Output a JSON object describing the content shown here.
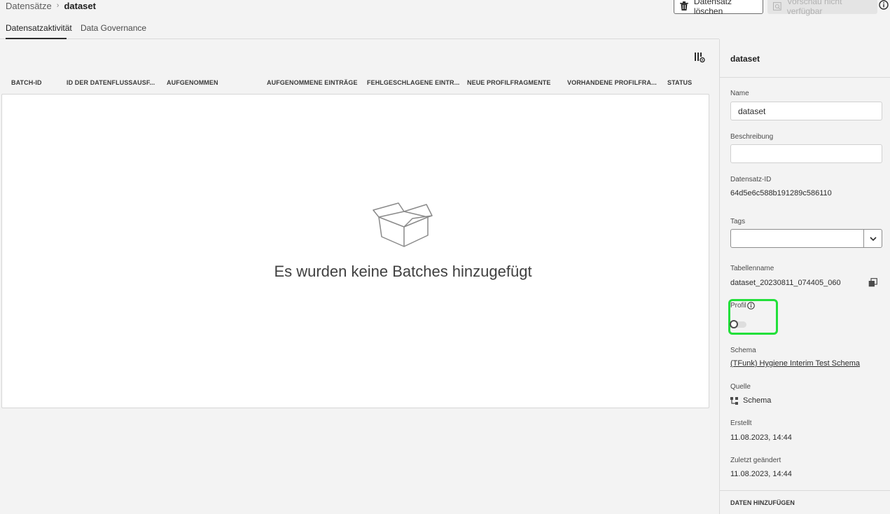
{
  "breadcrumb": {
    "parent": "Datensätze",
    "separator": "›",
    "current": "dataset"
  },
  "actions": {
    "delete_label": "Datensatz löschen",
    "preview_label": "Vorschau nicht verfügbar"
  },
  "tabs": [
    {
      "label": "Datensatzaktivität",
      "active": true
    },
    {
      "label": "Data Governance",
      "active": false
    }
  ],
  "table": {
    "columns": [
      "BATCH-ID",
      "ID DER DATENFLUSSAUSF...",
      "AUFGENOMMEN",
      "AUFGENOMMENE EINTRÄGE",
      "FEHLGESCHLAGENE EINTR...",
      "NEUE PROFILFRAGMENTE",
      "VORHANDENE PROFILFRA...",
      "STATUS"
    ],
    "rows": [],
    "empty_message": "Es wurden keine Batches hinzugefügt"
  },
  "panel": {
    "title": "dataset",
    "name_label": "Name",
    "name_value": "dataset",
    "description_label": "Beschreibung",
    "description_value": "",
    "dataset_id_label": "Datensatz-ID",
    "dataset_id_value": "64d5e6c588b191289c586110",
    "tags_label": "Tags",
    "table_name_label": "Tabellenname",
    "table_name_value": "dataset_20230811_074405_060",
    "profile_label": "Profil",
    "profile_enabled": false,
    "schema_label": "Schema",
    "schema_value": "(TFunk) Hygiene Interim Test Schema",
    "source_label": "Quelle",
    "source_value": "Schema",
    "created_label": "Erstellt",
    "created_value": "11.08.2023, 14:44",
    "modified_label": "Zuletzt geändert",
    "modified_value": "11.08.2023, 14:44",
    "add_data_label": "DATEN HINZUFÜGEN"
  },
  "colors": {
    "highlight": "#22e03a",
    "background": "#f3f3f3",
    "table_bg": "#ffffff"
  },
  "icons": [
    "trash-icon",
    "preview-icon",
    "info-icon",
    "column-settings-icon",
    "empty-box-icon",
    "chevron-down-icon",
    "copy-icon",
    "schema-icon"
  ]
}
